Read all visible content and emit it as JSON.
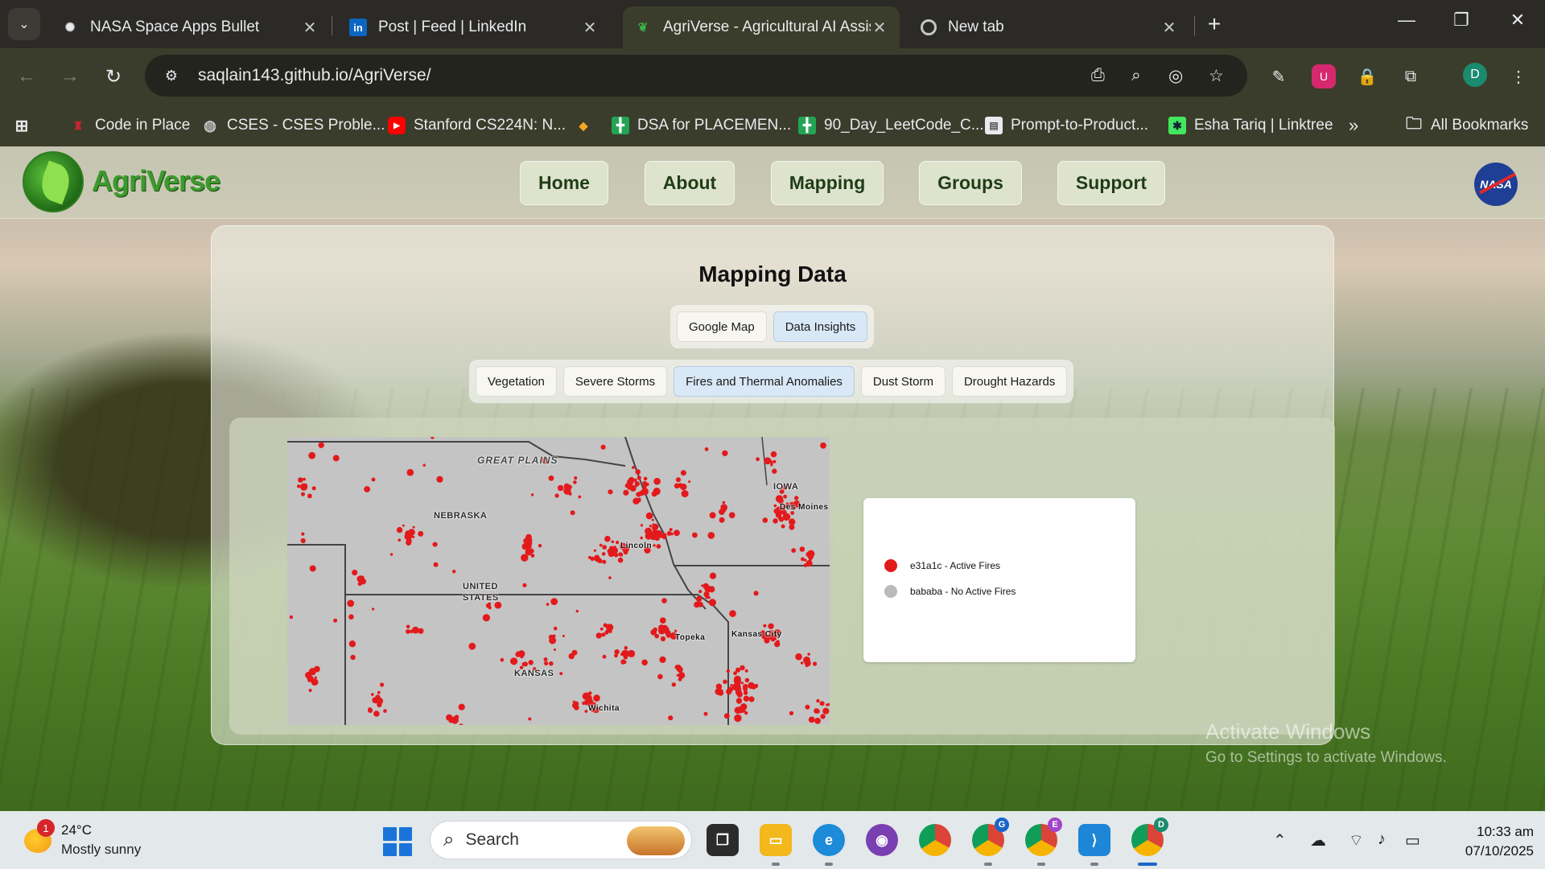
{
  "browser": {
    "tabs": [
      {
        "title": "NASA Space Apps Bullet",
        "icon": "openai-icon",
        "active": false
      },
      {
        "title": "Post | Feed | LinkedIn",
        "icon": "linkedin-icon",
        "active": false
      },
      {
        "title": "AgriVerse - Agricultural AI Assis",
        "icon": "agriverse-leaf-icon",
        "active": true
      },
      {
        "title": "New tab",
        "icon": "chrome-icon",
        "active": false
      }
    ],
    "url": "saqlain143.github.io/AgriVerse/",
    "profile_initial": "D",
    "bookmarks": [
      {
        "label": "Code in Place",
        "icon": "stanford-icon"
      },
      {
        "label": "CSES - CSES Proble...",
        "icon": "globe-icon"
      },
      {
        "label": "Stanford CS224N: N...",
        "icon": "youtube-icon"
      },
      {
        "label": "",
        "icon": "diamond-icon"
      },
      {
        "label": "DSA for PLACEMEN...",
        "icon": "sheet-icon"
      },
      {
        "label": "90_Day_LeetCode_C...",
        "icon": "sheet-icon"
      },
      {
        "label": "Prompt-to-Product...",
        "icon": "doc-icon"
      },
      {
        "label": "Esha Tariq | Linktree",
        "icon": "linktree-icon"
      }
    ],
    "all_bookmarks_label": "All Bookmarks",
    "overflow_label": "»"
  },
  "site": {
    "brand": "AgriVerse",
    "nav": [
      "Home",
      "About",
      "Mapping",
      "Groups",
      "Support"
    ],
    "nasa_logo_text": "NASA"
  },
  "mapping": {
    "title": "Mapping Data",
    "view_tabs": [
      {
        "label": "Google Map",
        "active": false
      },
      {
        "label": "Data Insights",
        "active": true
      }
    ],
    "layer_tabs": [
      {
        "label": "Vegetation",
        "active": false
      },
      {
        "label": "Severe Storms",
        "active": false
      },
      {
        "label": "Fires and Thermal Anomalies",
        "active": true
      },
      {
        "label": "Dust Storm",
        "active": false
      },
      {
        "label": "Drought Hazards",
        "active": false
      }
    ],
    "map_labels": {
      "region": "GREAT PLAINS",
      "nebraska": "NEBRASKA",
      "iowa": "IOWA",
      "des_moines": "Des Moines",
      "lincoln": "Lincoln",
      "united": "UNITED",
      "states": "STATES",
      "topeka": "Topeka",
      "kansas_city": "Kansas City",
      "kansas": "KANSAS",
      "wichita": "Wichita"
    },
    "legend": [
      {
        "label": "e31a1c - Active Fires",
        "color": "#e31a1c"
      },
      {
        "label": "bababa - No Active Fires",
        "color": "#bababa"
      }
    ]
  },
  "watermark": {
    "line1": "Activate Windows",
    "line2": "Go to Settings to activate Windows."
  },
  "taskbar": {
    "weather_badge": "1",
    "temperature": "24°C",
    "condition": "Mostly sunny",
    "search_label": "Search",
    "time": "10:33 am",
    "date": "07/10/2025",
    "badges": {
      "chrome_g": "G",
      "chrome_e": "E",
      "chrome_d": "D"
    }
  },
  "colors": {
    "fire": "#e31a1c",
    "no_fire": "#bababa",
    "brand_green": "#3c9a2c",
    "active_tab": "#d9e8f6"
  }
}
